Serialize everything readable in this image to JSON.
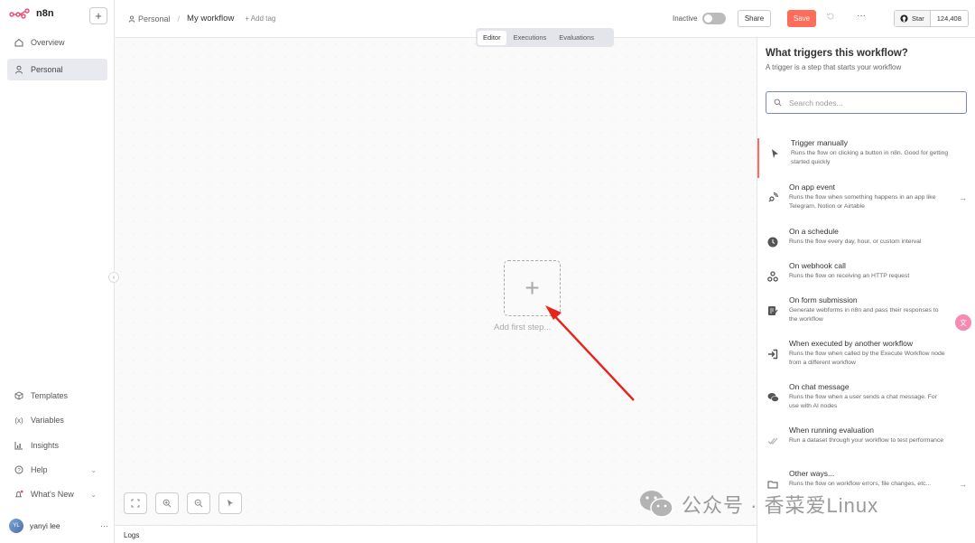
{
  "app": {
    "logo_text": "n8n"
  },
  "sidebar": {
    "top_items": [
      {
        "label": "Overview",
        "icon": "home-icon"
      },
      {
        "label": "Personal",
        "icon": "user-icon"
      }
    ],
    "bottom_items": [
      {
        "label": "Templates",
        "icon": "box-icon"
      },
      {
        "label": "Variables",
        "icon": "variables-icon"
      },
      {
        "label": "Insights",
        "icon": "chart-icon"
      },
      {
        "label": "Help",
        "icon": "help-icon"
      },
      {
        "label": "What's New",
        "icon": "bell-icon"
      }
    ],
    "user": {
      "initials": "YL",
      "name": "yanyi lee",
      "more": "···"
    }
  },
  "header": {
    "breadcrumb_project": "Personal",
    "breadcrumb_separator": "/",
    "workflow_name": "My workflow",
    "add_tag": "+ Add tag",
    "status_label": "Inactive",
    "share_label": "Share",
    "save_label": "Save",
    "more_label": "···",
    "github_star": "Star",
    "github_count": "124,408"
  },
  "tabs": [
    "Editor",
    "Executions",
    "Evaluations"
  ],
  "canvas": {
    "add_first_step": "Add first step...",
    "plus": "+"
  },
  "logs": {
    "label": "Logs"
  },
  "panel": {
    "title": "What triggers this workflow?",
    "subtitle": "A trigger is a step that starts your workflow",
    "search_placeholder": "Search nodes...",
    "triggers": [
      {
        "title": "Trigger manually",
        "desc": "Runs the flow on clicking a button in n8n. Good for getting started quickly",
        "icon": "cursor-icon",
        "arrow": false
      },
      {
        "title": "On app event",
        "desc": "Runs the flow when something happens in an app like Telegram, Notion or Airtable",
        "icon": "satellite-icon",
        "arrow": true
      },
      {
        "title": "On a schedule",
        "desc": "Runs the flow every day, hour, or custom interval",
        "icon": "clock-icon",
        "arrow": false
      },
      {
        "title": "On webhook call",
        "desc": "Runs the flow on receiving an HTTP request",
        "icon": "webhook-icon",
        "arrow": false
      },
      {
        "title": "On form submission",
        "desc": "Generate webforms in n8n and pass their responses to the workflow",
        "icon": "form-icon",
        "arrow": false
      },
      {
        "title": "When executed by another workflow",
        "desc": "Runs the flow when called by the Execute Workflow node from a different workflow",
        "icon": "sign-in-icon",
        "arrow": false
      },
      {
        "title": "On chat message",
        "desc": "Runs the flow when a user sends a chat message. For use with AI nodes",
        "icon": "chat-icon",
        "arrow": false
      },
      {
        "title": "When running evaluation",
        "desc": "Run a dataset through your workflow to test performance",
        "icon": "check-double-icon",
        "arrow": false
      },
      {
        "title": "Other ways...",
        "desc": "Runs the flow on workflow errors, file changes, etc...",
        "icon": "folder-icon",
        "arrow": true
      }
    ]
  },
  "watermark": {
    "text": "公众号 · 香菜爱Linux"
  },
  "colors": {
    "accent": "#ff6d5a",
    "annotation_arrow": "#e8231b",
    "search_border": "#7b83c4"
  }
}
